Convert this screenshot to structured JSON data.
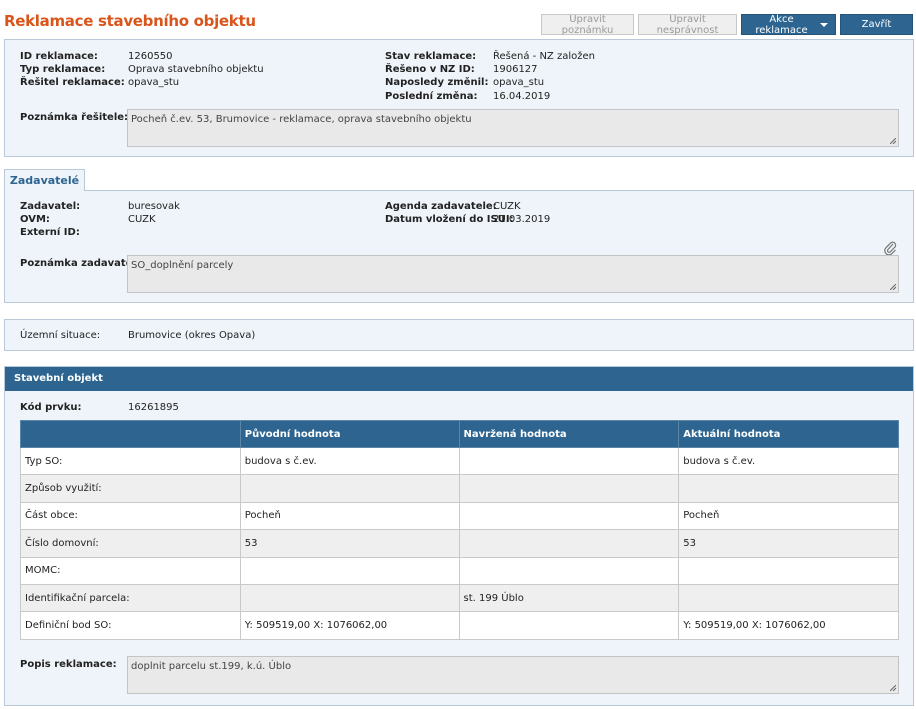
{
  "header": {
    "title": "Reklamace stavebního objektu",
    "buttons": {
      "edit_note": "Upravit poznámku",
      "edit_error": "Upravit nesprávnost",
      "actions": "Akce reklamace",
      "close": "Zavřít"
    }
  },
  "summary": {
    "id_label": "ID reklamace:",
    "id_value": "1260550",
    "type_label": "Typ reklamace:",
    "type_value": "Oprava stavebního objektu",
    "solver_label": "Řešitel reklamace:",
    "solver_value": "opava_stu",
    "state_label": "Stav reklamace:",
    "state_value": "Řešená - NZ založen",
    "nz_label": "Řešeno v NZ ID:",
    "nz_value": "1906127",
    "changed_by_label": "Naposledy změnil:",
    "changed_by_value": "opava_stu",
    "last_change_label": "Poslední změna:",
    "last_change_value": "16.04.2019",
    "note_label": "Poznámka řešitele:",
    "note_value": "Pocheň č.ev. 53, Brumovice - reklamace, oprava stavebního objektu"
  },
  "requesters": {
    "tab_label": "Zadavatelé",
    "requester_label": "Zadavatel:",
    "requester_value": "buresovak",
    "ovm_label": "OVM:",
    "ovm_value": "CUZK",
    "external_label": "Externí ID:",
    "external_value": "",
    "agenda_label": "Agenda zadavatele:",
    "agenda_value": "CUZK",
    "inserted_label": "Datum vložení do ISUI:",
    "inserted_value": "21.03.2019",
    "note_label": "Poznámka zadavatele:",
    "note_value": "SO_doplnění parcely"
  },
  "territory": {
    "label": "Územní situace:",
    "value": "Brumovice (okres Opava)"
  },
  "building": {
    "section_title": "Stavební objekt",
    "code_label": "Kód prvku:",
    "code_value": "16261895",
    "columns": [
      "",
      "Původní hodnota",
      "Navržená hodnota",
      "Aktuální hodnota"
    ],
    "rows": [
      [
        "Typ SO:",
        "budova s č.ev.",
        "",
        "budova s č.ev."
      ],
      [
        "Způsob využití:",
        "",
        "",
        ""
      ],
      [
        "Část obce:",
        "Pocheň",
        "",
        "Pocheň"
      ],
      [
        "Číslo domovní:",
        "53",
        "",
        "53"
      ],
      [
        "MOMC:",
        "",
        "",
        ""
      ],
      [
        "Identifikační parcela:",
        "",
        "st. 199 Úblo",
        ""
      ],
      [
        "Definiční bod SO:",
        "Y: 509519,00 X: 1076062,00",
        "",
        "Y: 509519,00 X: 1076062,00"
      ]
    ],
    "desc_label": "Popis reklamace:",
    "desc_value": "doplnit parcelu st.199, k.ú. Úblo"
  },
  "colors": {
    "title": "#d9551c",
    "primary": "#2d6590",
    "panel_bg": "#eef4fa"
  }
}
